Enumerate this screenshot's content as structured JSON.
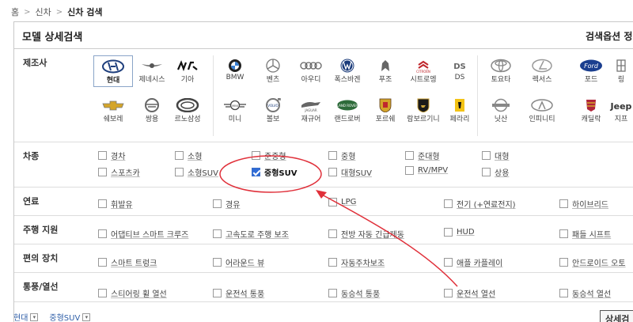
{
  "breadcrumb": [
    "홈",
    "신차",
    "신차 검색"
  ],
  "panel": {
    "title": "모델 상세검색",
    "options_label": "검색옵션 정"
  },
  "maker": {
    "label": "제조사",
    "brands": [
      {
        "name": "현대",
        "selected": true,
        "icon": "hyundai-logo"
      },
      {
        "name": "제네시스",
        "icon": "genesis-logo"
      },
      {
        "name": "기아",
        "icon": "kia-logo"
      },
      {
        "name": "BMW",
        "icon": "bmw-logo"
      },
      {
        "name": "벤츠",
        "icon": "mercedes-logo"
      },
      {
        "name": "아우디",
        "icon": "audi-logo"
      },
      {
        "name": "폭스바겐",
        "icon": "volkswagen-logo"
      },
      {
        "name": "푸조",
        "icon": "peugeot-logo"
      },
      {
        "name": "시트로엥",
        "icon": "citroen-logo"
      },
      {
        "name": "DS",
        "icon": "ds-logo"
      },
      {
        "name": "토요타",
        "icon": "toyota-logo"
      },
      {
        "name": "렉서스",
        "icon": "lexus-logo"
      },
      {
        "name": "포드",
        "icon": "ford-logo"
      },
      {
        "name": "링",
        "icon": "lincoln-logo"
      },
      {
        "name": "쉐보레",
        "icon": "chevrolet-logo"
      },
      {
        "name": "쌍용",
        "icon": "ssangyong-logo"
      },
      {
        "name": "르노삼성",
        "icon": "renault-samsung-logo"
      },
      {
        "name": "미니",
        "icon": "mini-logo"
      },
      {
        "name": "볼보",
        "icon": "volvo-logo"
      },
      {
        "name": "재규어",
        "icon": "jaguar-logo"
      },
      {
        "name": "랜드로버",
        "icon": "landrover-logo"
      },
      {
        "name": "포르쉐",
        "icon": "porsche-logo"
      },
      {
        "name": "람보르기니",
        "icon": "lamborghini-logo"
      },
      {
        "name": "페라리",
        "icon": "ferrari-logo"
      },
      {
        "name": "닛산",
        "icon": "nissan-logo"
      },
      {
        "name": "인피니티",
        "icon": "infiniti-logo"
      },
      {
        "name": "캐딜락",
        "icon": "cadillac-logo"
      },
      {
        "name": "지프",
        "icon": "jeep-logo"
      }
    ],
    "logo_text": {
      "ds": "DS",
      "jaguar": "JAGUAR",
      "landrover": "LAND ROVER",
      "jeep": "Jeep",
      "ford": "Ford",
      "citroen": "CITROËN",
      "mini": "MINI",
      "volvo": "VOLVO"
    }
  },
  "body_type": {
    "label": "차종",
    "options": [
      {
        "label": "경차",
        "checked": false
      },
      {
        "label": "소형",
        "checked": false
      },
      {
        "label": "준중형",
        "checked": false
      },
      {
        "label": "중형",
        "checked": false
      },
      {
        "label": "준대형",
        "checked": false
      },
      {
        "label": "대형",
        "checked": false
      },
      {
        "label": "스포츠카",
        "checked": false
      },
      {
        "label": "소형SUV",
        "checked": false
      },
      {
        "label": "중형SUV",
        "checked": true
      },
      {
        "label": "대형SUV",
        "checked": false
      },
      {
        "label": "RV/MPV",
        "checked": false
      },
      {
        "label": "상용",
        "checked": false
      }
    ]
  },
  "fuel": {
    "label": "연료",
    "options": [
      {
        "label": "휘발유"
      },
      {
        "label": "경유"
      },
      {
        "label": "LPG"
      },
      {
        "label": "전기 (+연료전지)"
      },
      {
        "label": "하이브리드"
      }
    ]
  },
  "driving": {
    "label": "주행 지원",
    "options": [
      {
        "label": "어댑티브 스마트 크루즈"
      },
      {
        "label": "고속도로 주행 보조"
      },
      {
        "label": "전방 자동 긴급제동"
      },
      {
        "label": "HUD"
      },
      {
        "label": "패들 시프트"
      }
    ]
  },
  "convenience": {
    "label": "편의 장치",
    "options": [
      {
        "label": "스마트 트렁크"
      },
      {
        "label": "어라운드 뷰"
      },
      {
        "label": "자동주차보조"
      },
      {
        "label": "애플 카플레이"
      },
      {
        "label": "안드로이드 오토"
      }
    ]
  },
  "ventilation": {
    "label": "통풍/열선",
    "options": [
      {
        "label": "스티어링 휠 열선"
      },
      {
        "label": "운전석 통풍"
      },
      {
        "label": "동승석 통풍"
      },
      {
        "label": "운전석 열선"
      },
      {
        "label": "동승석 열선"
      }
    ]
  },
  "selected_filters": [
    {
      "label": "현대"
    },
    {
      "label": "중형SUV"
    }
  ],
  "search_button": "상세검",
  "colors": {
    "annotation": "#e0303a",
    "checkbox_checked": "#2f6bd6",
    "hyundai_blue": "#1f3f7d",
    "ford_blue": "#1b3f8f"
  }
}
